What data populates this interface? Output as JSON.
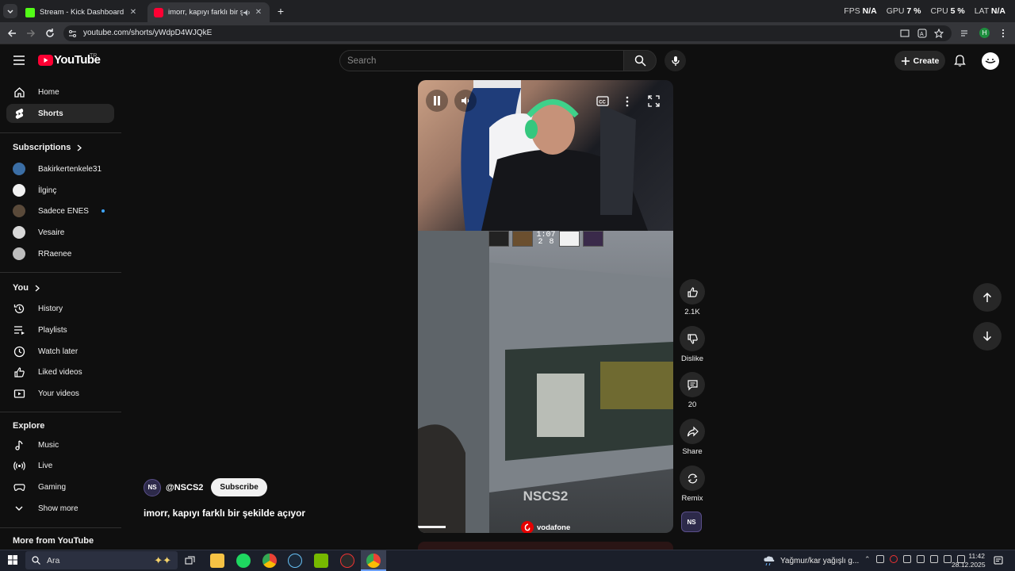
{
  "browser": {
    "tabs": [
      {
        "title": "Stream - Kick Dashboard",
        "active": false
      },
      {
        "title": "imorr, kapıyı farklı bir şekild",
        "active": true
      }
    ],
    "url": "youtube.com/shorts/yWdpD4WJQkE",
    "hud": {
      "fps_label": "FPS",
      "fps_value": "N/A",
      "gpu_label": "GPU",
      "gpu_value": "7 %",
      "cpu_label": "CPU",
      "cpu_value": "5 %",
      "lat_label": "LAT",
      "lat_value": "N/A"
    }
  },
  "header": {
    "logo": "YouTube",
    "country_code": "TR",
    "search_placeholder": "Search",
    "create_label": "Create"
  },
  "sidebar": {
    "main": [
      {
        "label": "Home",
        "icon": "home-icon"
      },
      {
        "label": "Shorts",
        "icon": "shorts-icon",
        "active": true
      }
    ],
    "subscriptions_title": "Subscriptions",
    "subscriptions": [
      {
        "label": "Bakirkertenkele31",
        "color": "#3b6ea5"
      },
      {
        "label": "İlginç",
        "color": "#f1f1f1"
      },
      {
        "label": "Sadece ENES",
        "color": "#5a4a3a",
        "live": true
      },
      {
        "label": "Vesaire",
        "color": "#d8d8d8"
      },
      {
        "label": "RRaenee",
        "color": "#bdbdbd"
      }
    ],
    "you_title": "You",
    "you": [
      {
        "label": "History",
        "icon": "history-icon"
      },
      {
        "label": "Playlists",
        "icon": "playlists-icon"
      },
      {
        "label": "Watch later",
        "icon": "watch-later-icon"
      },
      {
        "label": "Liked videos",
        "icon": "like-icon"
      },
      {
        "label": "Your videos",
        "icon": "your-videos-icon"
      }
    ],
    "explore_title": "Explore",
    "explore": [
      {
        "label": "Music",
        "icon": "music-icon"
      },
      {
        "label": "Live",
        "icon": "live-icon"
      },
      {
        "label": "Gaming",
        "icon": "gaming-icon"
      },
      {
        "label": "Show more",
        "icon": "chevron-down-icon"
      }
    ],
    "more_title": "More from YouTube"
  },
  "player": {
    "match_time": "1:07",
    "score_left": "2",
    "score_right": "8",
    "watermark": "NSCS2",
    "sponsor": "vodafone",
    "progress": 0.11
  },
  "video": {
    "channel": "@NSCS2",
    "channel_avatar_text": "NS",
    "subscribe_label": "Subscribe",
    "title": "imorr, kapıyı farklı bir şekilde açıyor"
  },
  "actions": {
    "likes": "2.1K",
    "dislike_label": "Dislike",
    "comments": "20",
    "share_label": "Share",
    "remix_label": "Remix"
  },
  "taskbar": {
    "search_label": "Ara",
    "weather": "Yağmur/kar yağışlı g...",
    "time": "11:42",
    "date": "28.12.2025"
  }
}
